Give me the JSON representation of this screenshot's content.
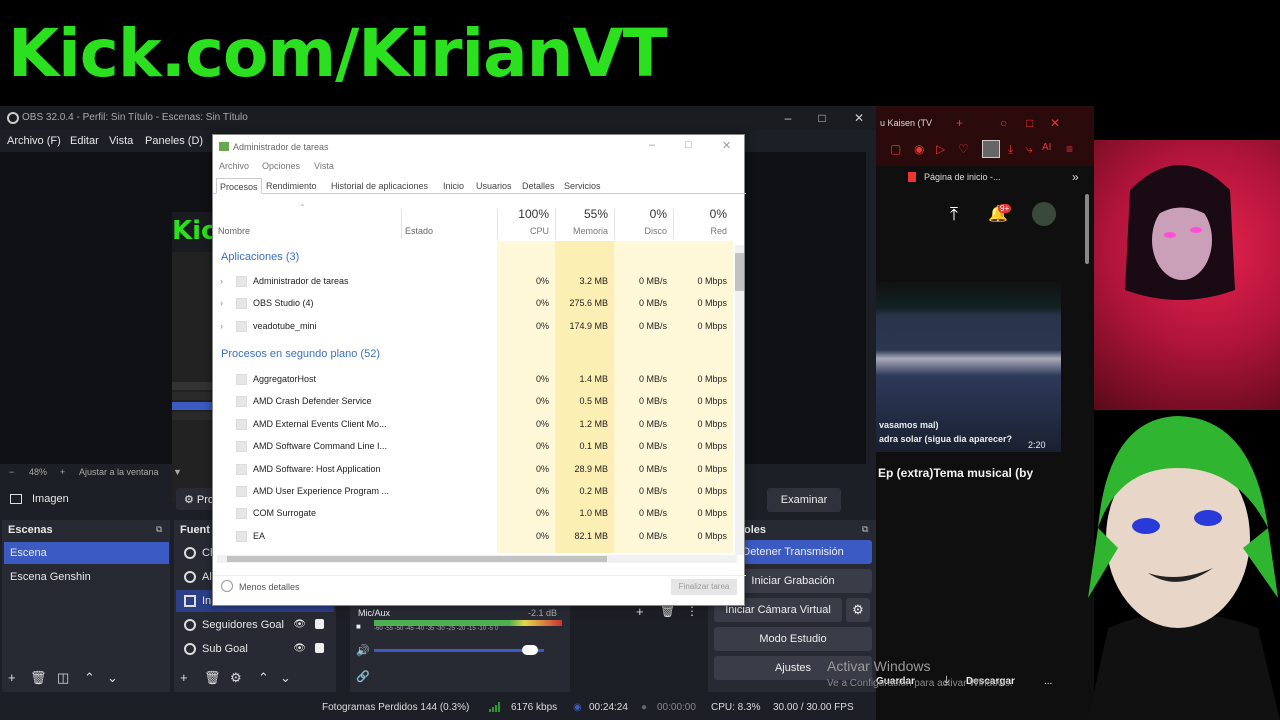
{
  "banner": {
    "text": "Kick.com/KirianVT"
  },
  "obs": {
    "title": "OBS 32.0.4 - Perfil: Sin Título - Escenas: Sin Título",
    "menu": [
      "Archivo (F)",
      "Editar",
      "Vista",
      "Paneles (D)"
    ],
    "preview_mini_text": "Kic",
    "zoom": "48%",
    "fit_label": "Ajustar a la ventana",
    "source_toolbar": {
      "selected_source": "Imagen",
      "properties": "Pro",
      "browse": "Examinar"
    },
    "scenes": {
      "title": "Escenas",
      "items": [
        {
          "label": "Escena",
          "selected": true
        },
        {
          "label": "Escena Genshin",
          "selected": false
        }
      ]
    },
    "sources": {
      "title": "Fuent",
      "items": [
        {
          "label": "Ch",
          "selected": false
        },
        {
          "label": "Al",
          "selected": false
        },
        {
          "label": "In",
          "selected": true
        },
        {
          "label": "Seguidores Goal",
          "selected": false
        },
        {
          "label": "Sub Goal",
          "selected": false
        }
      ]
    },
    "mixer": {
      "channel": "Mic/Aux",
      "db": "-2.1 dB",
      "scale": "-60 -55 -50 -45 -40 -35 -30 -25 -20 -15 -10 -5 0",
      "volume": 0.92
    },
    "controls": {
      "title": "oles",
      "stream": "Detener Transmisión",
      "record": "Iniciar Grabación",
      "virtual_cam": "Iniciar Cámara Virtual",
      "studio": "Modo Estudio",
      "settings": "Ajustes"
    },
    "status": {
      "dropped": "Fotogramas Perdidos 144 (0.3%)",
      "bitrate": "6176 kbps",
      "stream_time": "00:24:24",
      "record_time": "00:00:00",
      "cpu": "CPU: 8.3%",
      "fps": "30.00 / 30.00 FPS"
    }
  },
  "taskmanager": {
    "title": "Administrador de tareas",
    "menu": [
      "Archivo",
      "Opciones",
      "Vista"
    ],
    "tabs": [
      "Procesos",
      "Rendimiento",
      "Historial de aplicaciones",
      "Inicio",
      "Usuarios",
      "Detalles",
      "Servicios"
    ],
    "columns": {
      "name": "Nombre",
      "state": "Estado",
      "cpu": {
        "pct": "100%",
        "label": "CPU"
      },
      "mem": {
        "pct": "55%",
        "label": "Memoria"
      },
      "disk": {
        "pct": "0%",
        "label": "Disco"
      },
      "net": {
        "pct": "0%",
        "label": "Red"
      }
    },
    "groups": [
      {
        "label": "Aplicaciones (3)",
        "rows": [
          {
            "name": "Administrador de tareas",
            "cpu": "0%",
            "mem": "3.2 MB",
            "disk": "0 MB/s",
            "net": "0 Mbps"
          },
          {
            "name": "OBS Studio (4)",
            "cpu": "0%",
            "mem": "275.6 MB",
            "disk": "0 MB/s",
            "net": "0 Mbps"
          },
          {
            "name": "veadotube_mini",
            "cpu": "0%",
            "mem": "174.9 MB",
            "disk": "0 MB/s",
            "net": "0 Mbps"
          }
        ]
      },
      {
        "label": "Procesos en segundo plano (52)",
        "rows": [
          {
            "name": "AggregatorHost",
            "cpu": "0%",
            "mem": "1.4 MB",
            "disk": "0 MB/s",
            "net": "0 Mbps"
          },
          {
            "name": "AMD Crash Defender Service",
            "cpu": "0%",
            "mem": "0.5 MB",
            "disk": "0 MB/s",
            "net": "0 Mbps"
          },
          {
            "name": "AMD External Events Client Mo...",
            "cpu": "0%",
            "mem": "1.2 MB",
            "disk": "0 MB/s",
            "net": "0 Mbps"
          },
          {
            "name": "AMD Software Command Line I...",
            "cpu": "0%",
            "mem": "0.1 MB",
            "disk": "0 MB/s",
            "net": "0 Mbps"
          },
          {
            "name": "AMD Software: Host Application",
            "cpu": "0%",
            "mem": "28.9 MB",
            "disk": "0 MB/s",
            "net": "0 Mbps"
          },
          {
            "name": "AMD User Experience Program ...",
            "cpu": "0%",
            "mem": "0.2 MB",
            "disk": "0 MB/s",
            "net": "0 Mbps"
          },
          {
            "name": "COM Surrogate",
            "cpu": "0%",
            "mem": "1.0 MB",
            "disk": "0 MB/s",
            "net": "0 Mbps"
          },
          {
            "name": "EA",
            "cpu": "0%",
            "mem": "82.1 MB",
            "disk": "0 MB/s",
            "net": "0 Mbps"
          }
        ]
      }
    ],
    "less_details": "Menos detalles",
    "end_task": "Finalizar tarea"
  },
  "browser": {
    "tab_title": "u Kaisen (TV",
    "bookmark": "Página de inicio -...",
    "notif_count": "9+",
    "subtitle1": "vasamos mal)",
    "subtitle2": "adra solar (sigua dia aparecer?",
    "duration": "2:20",
    "video_title": "Ep (extra)Tema musical (by",
    "save": "Guardar",
    "download": "Descargar",
    "more": "..."
  },
  "watermark": {
    "line1": "Activar Windows",
    "line2": "Ve a Configuración para activar Windows."
  },
  "colors": {
    "accent": "#3c5bc2",
    "kick_green": "#2be01e",
    "tm_yellow": "#fff8d8"
  }
}
